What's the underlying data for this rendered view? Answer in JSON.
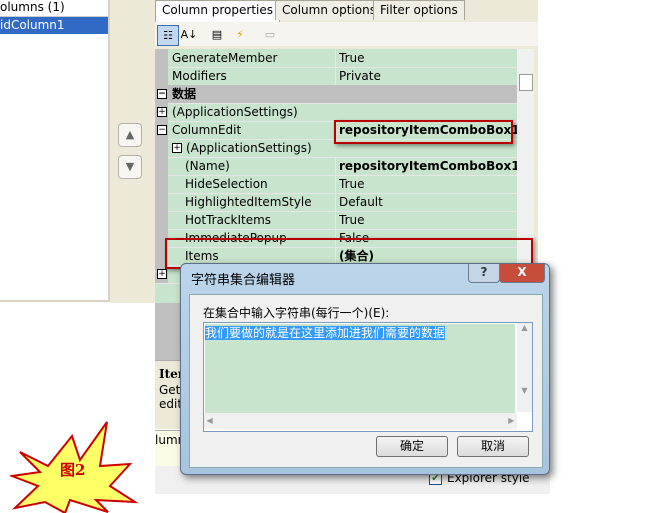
{
  "left": {
    "header": "olumns (1)",
    "selected": "idColumn1"
  },
  "nav": {
    "up_icon": "▲",
    "down_icon": "▼"
  },
  "tabs": [
    {
      "label": "Column properties"
    },
    {
      "label": "Column options"
    },
    {
      "label": "Filter options"
    }
  ],
  "grid": {
    "rows": [
      {
        "name": "GenerateMember",
        "value": "True"
      },
      {
        "name": "Modifiers",
        "value": "Private"
      },
      {
        "name": "数据",
        "value": "",
        "category": true
      },
      {
        "name": "(ApplicationSettings)",
        "value": ""
      },
      {
        "name": "ColumnEdit",
        "value": "repositoryItemComboBox1"
      },
      {
        "name": "(ApplicationSettings)",
        "value": ""
      },
      {
        "name": "(Name)",
        "value": "repositoryItemComboBox1"
      },
      {
        "name": "HideSelection",
        "value": "True"
      },
      {
        "name": "HighlightedItemStyle",
        "value": "Default"
      },
      {
        "name": "HotTrackItems",
        "value": "True"
      },
      {
        "name": "ImmediatePopup",
        "value": "False"
      },
      {
        "name": "Items",
        "value": "(集合)"
      }
    ]
  },
  "desc": {
    "title": "Iter",
    "line1": "Gets",
    "line2": "edit"
  },
  "yellow": "lumn",
  "bottom": {
    "checkbox_label": "Explorer style",
    "checked": true
  },
  "dialog": {
    "title": "字符串集合编辑器",
    "help": "?",
    "close": "X",
    "label": "在集合中输入字符串(每行一个)(E):",
    "text": "我们要做的就是在这里添加进我们需要的数据",
    "ok": "确定",
    "cancel": "取消"
  },
  "badge": {
    "text": "图2",
    "fill": "#ffff66",
    "stroke": "#cc0000"
  }
}
